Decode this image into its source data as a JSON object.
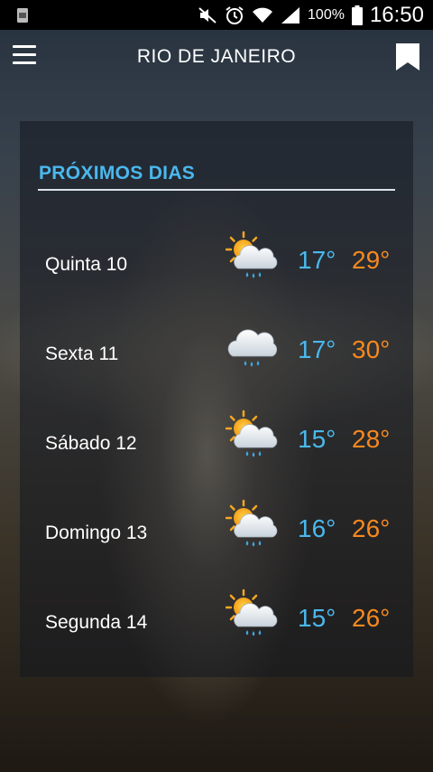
{
  "status_bar": {
    "battery_pct": "100%",
    "time": "16:50",
    "icons": [
      "notification-icon",
      "mute-icon",
      "alarm-icon",
      "wifi-icon",
      "signal-icon",
      "battery-icon"
    ]
  },
  "header": {
    "title": "RIO DE JANEIRO",
    "menu_icon": "menu-icon",
    "bookmark_icon": "bookmark-icon"
  },
  "forecast": {
    "section_title": "PRÓXIMOS DIAS",
    "days": [
      {
        "name": "Quinta 10",
        "icon": "partly-cloudy-rain-icon",
        "min": "17°",
        "max": "29°"
      },
      {
        "name": "Sexta 11",
        "icon": "cloud-rain-icon",
        "min": "17°",
        "max": "30°"
      },
      {
        "name": "Sábado 12",
        "icon": "partly-cloudy-rain-icon",
        "min": "15°",
        "max": "28°"
      },
      {
        "name": "Domingo 13",
        "icon": "partly-cloudy-rain-icon",
        "min": "16°",
        "max": "26°"
      },
      {
        "name": "Segunda 14",
        "icon": "partly-cloudy-rain-icon",
        "min": "15°",
        "max": "26°"
      }
    ]
  },
  "colors": {
    "accent_blue": "#4ab8ee",
    "accent_orange": "#f7891f"
  }
}
